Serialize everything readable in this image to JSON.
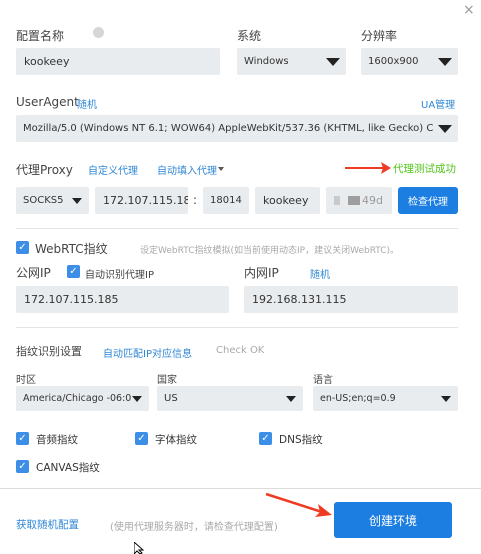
{
  "window": {
    "close_glyph": "×"
  },
  "profile": {
    "name_label": "配置名称",
    "name_value": "kookeey"
  },
  "system": {
    "label": "系统",
    "value": "Windows"
  },
  "resolution": {
    "label": "分辨率",
    "value": "1600x900"
  },
  "useragent": {
    "label": "UserAgent",
    "random_link": "随机",
    "manage_link": "UA管理",
    "value": "Mozilla/5.0 (Windows NT 6.1; WOW64) AppleWebKit/537.36 (KHTML, like Gecko) Chrome/57..."
  },
  "proxy": {
    "label": "代理Proxy",
    "custom_link": "自定义代理",
    "autofill_link": "自动填入代理",
    "status": "代理测试成功",
    "type": "SOCKS5",
    "host": "172.107.115.18",
    "colon": ":",
    "port": "18014",
    "username": "kookeey",
    "password_tail": "49d",
    "check_button": "检查代理"
  },
  "webrtc": {
    "label": "WebRTC指纹",
    "hint": "设定WebRTC指纹模拟(如当前使用动态IP，建议关闭WebRTC)。",
    "public_ip_label": "公网IP",
    "auto_detect_label": "自动识别代理IP",
    "public_ip_value": "172.107.115.185",
    "internal_ip_label": "内网IP",
    "internal_random_link": "随机",
    "internal_ip_value": "192.168.131.115"
  },
  "fingerprint": {
    "label": "指纹识别设置",
    "auto_match_link": "自动匹配IP对应信息",
    "check_ok": "Check OK",
    "timezone_label": "时区",
    "timezone_value": "America/Chicago -06:0",
    "country_label": "国家",
    "country_value": "US",
    "language_label": "语言",
    "language_value": "en-US;en;q=0.9"
  },
  "options": {
    "audio": "音频指纹",
    "font": "字体指纹",
    "dns": "DNS指纹",
    "canvas": "CANVAS指纹"
  },
  "footer": {
    "random_config_link": "获取随机配置",
    "note": "(使用代理服务器时，请检查代理配置)",
    "create_button": "创建环境"
  },
  "colors": {
    "accent": "#1d7ee2",
    "success": "#52c41a",
    "arrow": "#ee3b22"
  }
}
